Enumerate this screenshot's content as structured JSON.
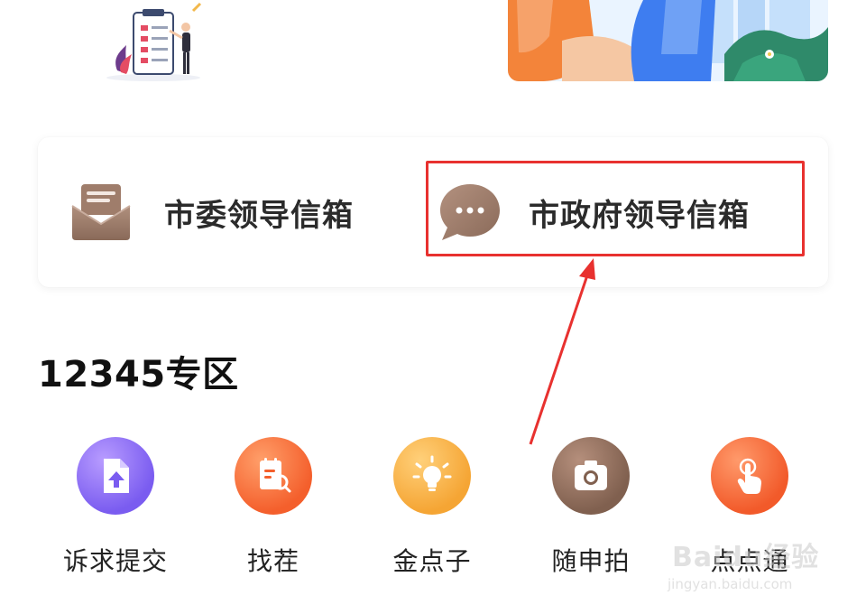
{
  "mailboxes": {
    "party": {
      "label": "市委领导信箱",
      "icon": "envelope-icon"
    },
    "government": {
      "label": "市政府领导信箱",
      "icon": "chat-bubble-icon"
    }
  },
  "section": {
    "title": "12345专区"
  },
  "services": [
    {
      "label": "诉求提交",
      "icon": "upload-document-icon",
      "color": "#7a5cf0"
    },
    {
      "label": "找茬",
      "icon": "search-document-icon",
      "color": "#f45f2c"
    },
    {
      "label": "金点子",
      "icon": "lightbulb-icon",
      "color": "#f5a534"
    },
    {
      "label": "随申拍",
      "icon": "camera-icon",
      "color": "#80604f"
    },
    {
      "label": "点点通",
      "icon": "tap-hand-icon",
      "color": "#f25a2a"
    }
  ],
  "annotation": {
    "highlight_color": "#e8312f"
  },
  "watermark": {
    "brand": "Baidu经验",
    "url": "jingyan.baidu.com"
  }
}
